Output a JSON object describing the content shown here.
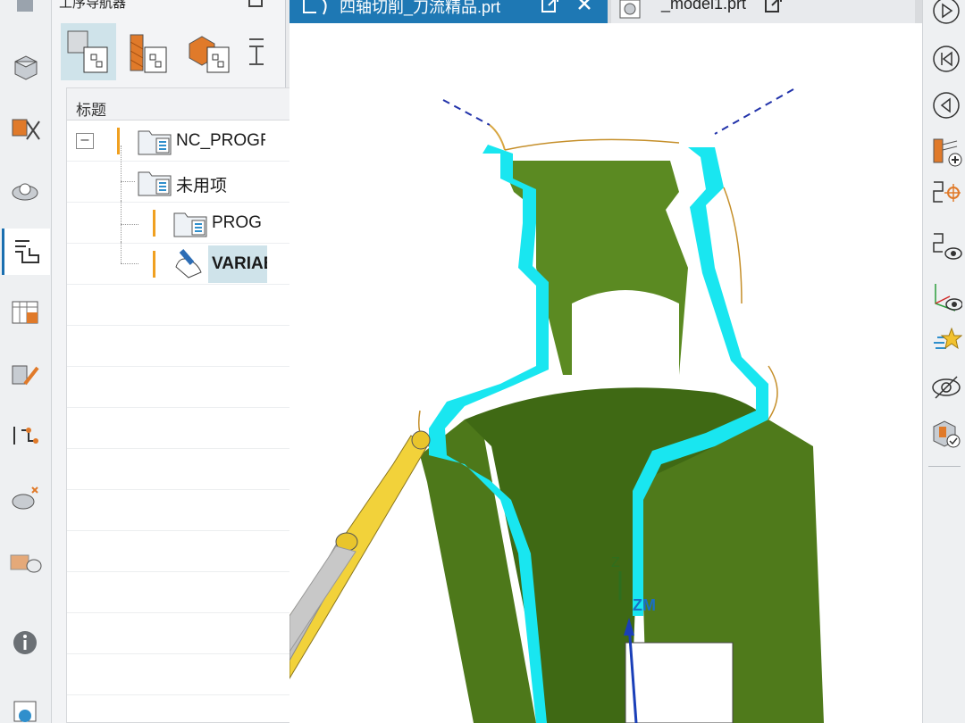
{
  "navigator": {
    "title": "工序导航器",
    "column_header": "标题",
    "rows": [
      {
        "label": "NC_PROGRAM"
      },
      {
        "label": "未用项"
      },
      {
        "label": "PROGRAM"
      },
      {
        "label": "VARIABLE_CONTOUR"
      }
    ]
  },
  "tabs": [
    {
      "label": "四轴切削_刀流精品.prt"
    },
    {
      "label": "_model1.prt"
    }
  ],
  "viewport": {
    "axis_labels": {
      "z": "Z",
      "zm": "ZM"
    }
  },
  "colors": {
    "accent": "#1e78b4",
    "part_green": "#4f7a1b",
    "toolpath_cyan": "#19e6f0",
    "tool_yellow": "#f2d23a"
  },
  "icons": {
    "resource_bar": [
      "part-navigator-icon",
      "assembly-navigator-icon",
      "constraint-navigator-icon",
      "operation-navigator-icon",
      "machine-tool-icon",
      "machining-feature-icon",
      "process-icon",
      "reuse-library-icon",
      "roles-icon",
      "history-icon",
      "info-icon",
      "web-browser-icon"
    ],
    "right_bar": [
      "play-icon",
      "rewind-icon",
      "step-back-icon",
      "generate-toolpath-icon",
      "verify-toolpath-icon",
      "replay-toolpath-icon",
      "show-tool-axis-icon",
      "simulate-icon",
      "hide-icon",
      "check-icon"
    ]
  }
}
